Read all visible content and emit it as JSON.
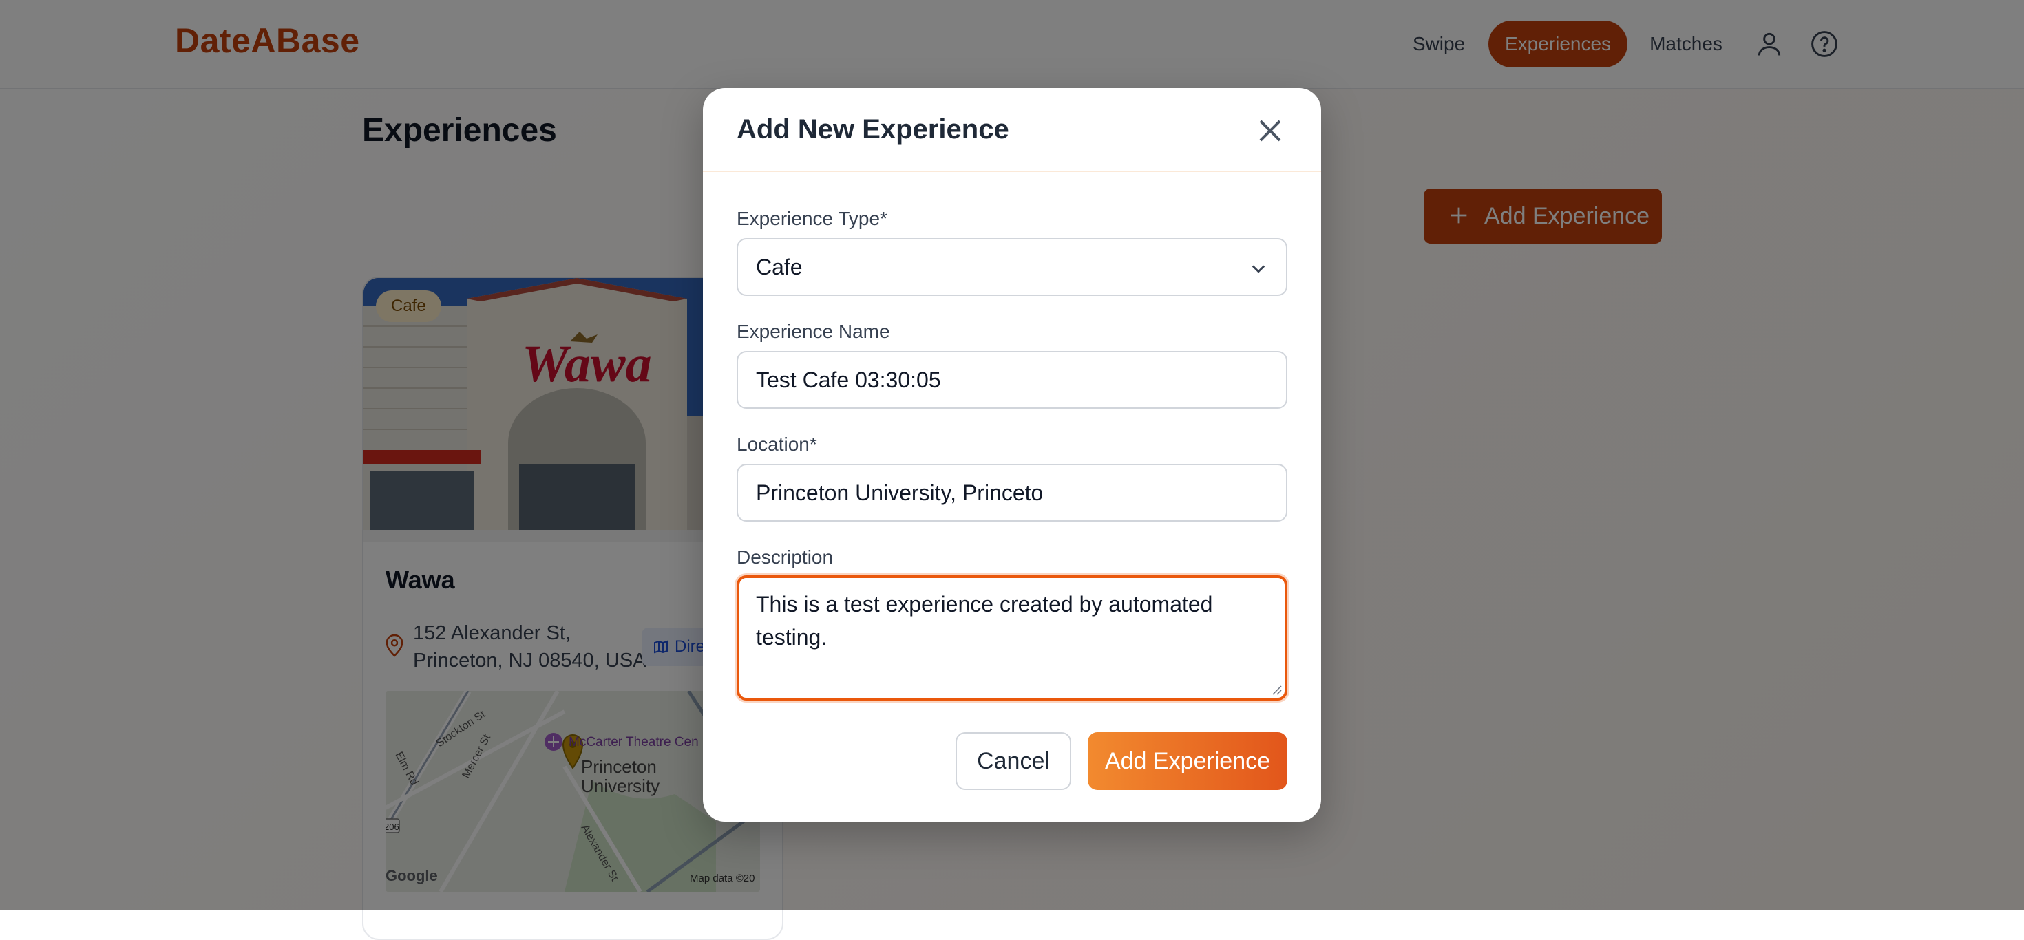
{
  "app": {
    "logo": "DateABase",
    "nav": {
      "swipe": "Swipe",
      "experiences": "Experiences",
      "matches": "Matches",
      "profile_icon": "user-icon",
      "help_icon": "help-icon",
      "active": "Experiences"
    }
  },
  "page": {
    "title": "Experiences",
    "add_button": "Add Experience",
    "card": {
      "badge": "Cafe",
      "sign_text": "Wawa",
      "name": "Wawa",
      "address_line1": "152 Alexander St,",
      "address_line2": "Princeton, NJ 08540, USA",
      "directions_label": "Dire",
      "map": {
        "poi": "McCarter Theatre Cen",
        "place_line1": "Princeton",
        "place_line2": "University",
        "streets": [
          "Elm Rd",
          "Stockton St",
          "Mercer St",
          "Alexander St"
        ],
        "route_shield": "206",
        "google": "Google",
        "credit": "Map data ©20"
      }
    }
  },
  "modal": {
    "title": "Add New Experience",
    "type_label": "Experience Type*",
    "type_value": "Cafe",
    "name_label": "Experience Name",
    "name_value": "Test Cafe 03:30:05",
    "location_label": "Location*",
    "location_value": "Princeton University, Princeto",
    "description_label": "Description",
    "description_value": "This is a test experience created by automated testing.",
    "cancel": "Cancel",
    "submit": "Add Experience"
  },
  "colors": {
    "brand": "#c2410c",
    "accent_start": "#f28a2f",
    "accent_end": "#e2561b",
    "focus": "#ea580c"
  }
}
